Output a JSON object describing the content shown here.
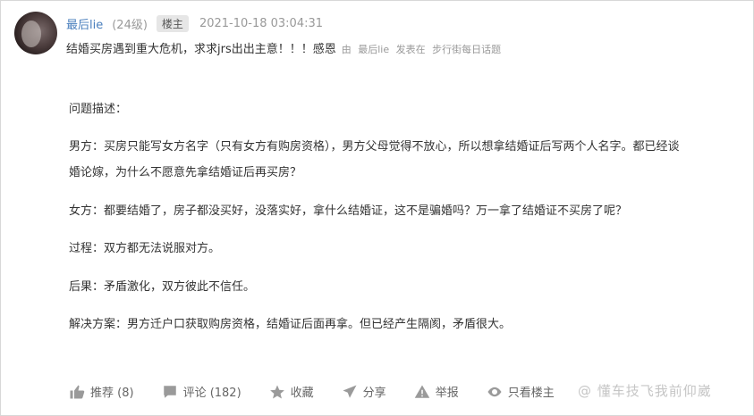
{
  "post": {
    "username": "最后lie",
    "level": "(24级)",
    "badge": "楼主",
    "timestamp": "2021-10-18 03:04:31",
    "title": "结婚买房遇到重大危机，求求jrs出出主意！！！感恩",
    "meta_by": "由",
    "meta_user": "最后lie",
    "meta_posted": "发表在",
    "meta_board": "步行街每日话题"
  },
  "content": {
    "p1": "问题描述：",
    "p2a": "男方：买房只能写女方名字（只有女方有购房资格），男方父母觉得不放心，所以想拿结婚证后写两个人名字。都已经谈",
    "p2b": "婚论嫁，为什么不愿意先拿结婚证后再买房？",
    "p3": "女方：都要结婚了，房子都没买好，没落实好，拿什么结婚证，这不是骗婚吗？万一拿了结婚证不买房了呢？",
    "p4": "过程：双方都无法说服对方。",
    "p5": "后果：矛盾激化，双方彼此不信任。",
    "p6": "解决方案：男方迁户口获取购房资格，结婚证后面再拿。但已经产生隔阂，矛盾很大。"
  },
  "toolbar": {
    "recommend": "推荐 (8)",
    "comment": "评论 (182)",
    "favorite": "收藏",
    "share": "分享",
    "report": "举报",
    "only_op": "只看楼主"
  },
  "watermark": "@ 懂车技飞我前仰崴",
  "icons": [
    "thumbs-up-icon",
    "comment-icon",
    "star-icon",
    "share-icon",
    "report-icon",
    "eye-icon"
  ]
}
